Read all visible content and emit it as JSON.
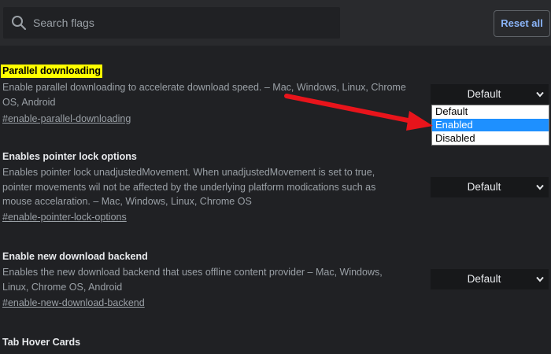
{
  "search": {
    "placeholder": "Search flags",
    "icon": "search-icon"
  },
  "toolbar": {
    "reset_label": "Reset all"
  },
  "flags": [
    {
      "title": "Parallel downloading",
      "highlighted": true,
      "description_lines": [
        "Enable parallel downloading to accelerate download speed. – Mac, Windows, Linux, Chrome",
        "OS, Android"
      ],
      "link": "#enable-parallel-downloading",
      "selected": "Default",
      "dropdown_open": true
    },
    {
      "title": "Enables pointer lock options",
      "highlighted": false,
      "description_lines": [
        "Enables pointer lock unadjustedMovement. When unadjustedMovement is set to true,",
        "pointer movements wil not be affected by the underlying platform modications such as",
        "mouse accelaration. – Mac, Windows, Linux, Chrome OS"
      ],
      "link": "#enable-pointer-lock-options",
      "selected": "Default"
    },
    {
      "title": "Enable new download backend",
      "highlighted": false,
      "description_lines": [
        "Enables the new download backend that uses offline content provider – Mac, Windows,",
        "Linux, Chrome OS, Android"
      ],
      "link": "#enable-new-download-backend",
      "selected": "Default"
    },
    {
      "title": "Tab Hover Cards",
      "highlighted": false
    }
  ],
  "dropdown": {
    "options": [
      "Default",
      "Enabled",
      "Disabled"
    ],
    "hovered": "Enabled"
  },
  "colors": {
    "background": "#202124",
    "toolbar": "#292a2d",
    "highlight": "#ffff00",
    "accent": "#8ab4f8",
    "arrow": "#e8141b",
    "dropdown_selected": "#1e90ff"
  }
}
